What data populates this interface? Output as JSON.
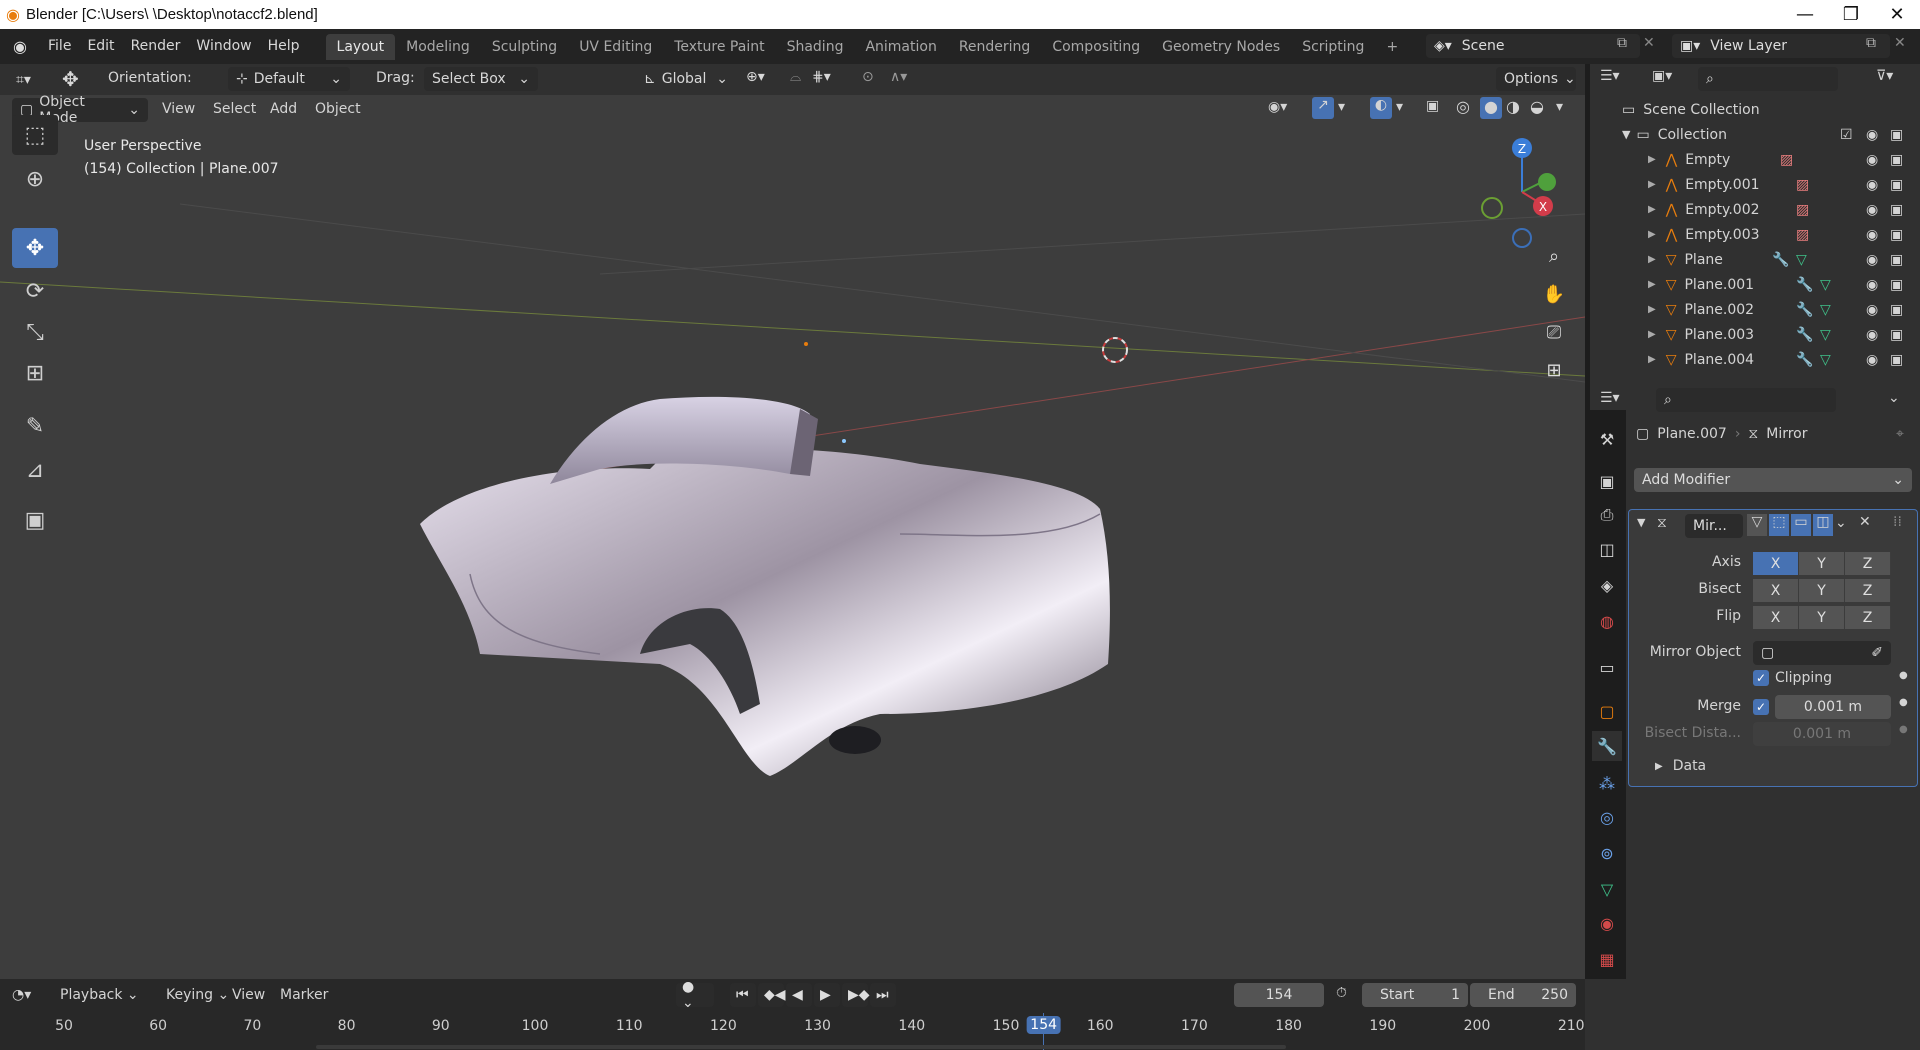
{
  "window": {
    "title": "Blender [C:\\Users\\        \\Desktop\\notaccf2.blend]"
  },
  "menus": [
    "File",
    "Edit",
    "Render",
    "Window",
    "Help"
  ],
  "workspaces": [
    "Layout",
    "Modeling",
    "Sculpting",
    "UV Editing",
    "Texture Paint",
    "Shading",
    "Animation",
    "Rendering",
    "Compositing",
    "Geometry Nodes",
    "Scripting"
  ],
  "scene": "Scene",
  "view_layer": "View Layer",
  "tool_header": {
    "orientation_label": "Orientation:",
    "orientation": "Default",
    "drag_label": "Drag:",
    "drag": "Select Box",
    "transform": "Global",
    "options": "Options"
  },
  "viewport_header": {
    "mode": "Object Mode",
    "view": "View",
    "select": "Select",
    "add": "Add",
    "object": "Object"
  },
  "overlay": {
    "line1": "User Perspective",
    "line2": "(154) Collection | Plane.007"
  },
  "gizmo": {
    "z": "Z",
    "x": "X"
  },
  "outliner": {
    "scene_collection": "Scene Collection",
    "collection": "Collection",
    "items": [
      {
        "name": "Empty",
        "type": "empty"
      },
      {
        "name": "Empty.001",
        "type": "empty"
      },
      {
        "name": "Empty.002",
        "type": "empty"
      },
      {
        "name": "Empty.003",
        "type": "empty"
      },
      {
        "name": "Plane",
        "type": "mesh"
      },
      {
        "name": "Plane.001",
        "type": "mesh"
      },
      {
        "name": "Plane.002",
        "type": "mesh"
      },
      {
        "name": "Plane.003",
        "type": "mesh"
      },
      {
        "name": "Plane.004",
        "type": "mesh"
      }
    ]
  },
  "properties": {
    "object": "Plane.007",
    "modifier_name": "Mirror",
    "add_modifier": "Add Modifier",
    "panel_name": "Mir...",
    "axis_label": "Axis",
    "bisect_label": "Bisect",
    "flip_label": "Flip",
    "xyz": [
      "X",
      "Y",
      "Z"
    ],
    "mirror_object_label": "Mirror Object",
    "clipping_label": "Clipping",
    "merge_label": "Merge",
    "merge_value": "0.001 m",
    "bisect_distance_label": "Bisect Dista...",
    "bisect_distance_value": "0.001 m",
    "data_label": "Data"
  },
  "timeline": {
    "playback": "Playback",
    "keying": "Keying",
    "view": "View",
    "marker": "Marker",
    "current_frame": "154",
    "start_label": "Start",
    "start": "1",
    "end_label": "End",
    "end": "250",
    "ticks": [
      "50",
      "60",
      "70",
      "80",
      "90",
      "100",
      "110",
      "120",
      "130",
      "140",
      "150",
      "154",
      "160",
      "170",
      "180",
      "190",
      "200",
      "210"
    ]
  },
  "colors": {
    "accent": "#4772b3",
    "viewport_bg": "#3d3d3d",
    "orange": "#e87d0d"
  }
}
